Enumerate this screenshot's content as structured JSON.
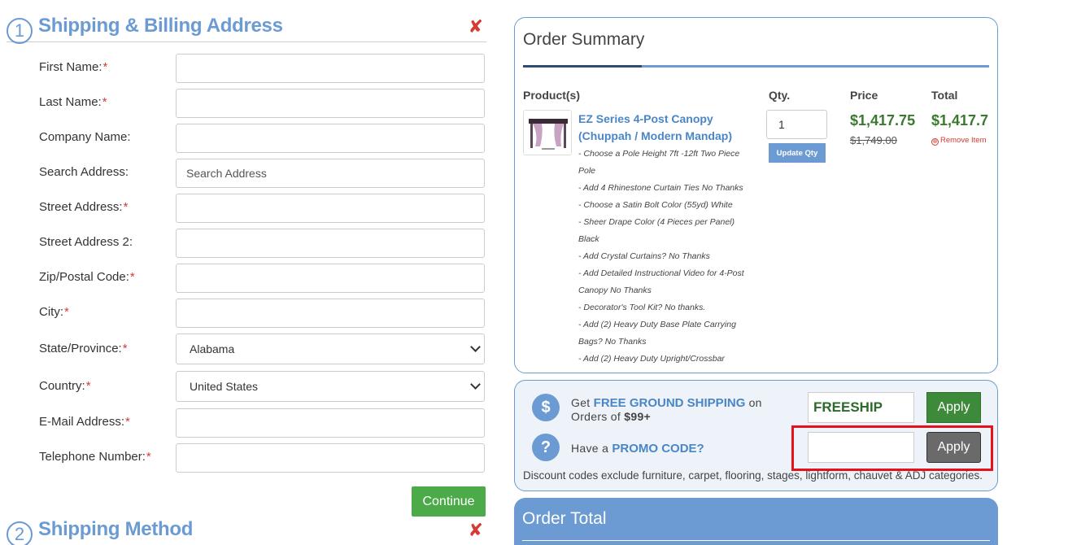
{
  "shipping": {
    "step": "1",
    "title": "Shipping & Billing Address",
    "close_icon": "✘",
    "fields": [
      {
        "label": "First Name:",
        "required": "*",
        "value": "",
        "placeholder": ""
      },
      {
        "label": "Last Name:",
        "required": "*",
        "value": "",
        "placeholder": ""
      },
      {
        "label": "Company Name:",
        "required": "",
        "value": "",
        "placeholder": ""
      },
      {
        "label": "Search Address:",
        "required": "",
        "value": "",
        "placeholder": "Search Address"
      },
      {
        "label": "Street Address:",
        "required": "*",
        "value": "",
        "placeholder": ""
      },
      {
        "label": "Street Address 2:",
        "required": "",
        "value": "",
        "placeholder": ""
      },
      {
        "label": "Zip/Postal Code:",
        "required": "*",
        "value": "",
        "placeholder": ""
      },
      {
        "label": "City:",
        "required": "*",
        "value": "",
        "placeholder": ""
      },
      {
        "label": "State/Province:",
        "required": "*",
        "selected": "Alabama"
      },
      {
        "label": "Country:",
        "required": "*",
        "selected": "United States"
      },
      {
        "label": "E-Mail Address:",
        "required": "*",
        "value": "",
        "placeholder": ""
      },
      {
        "label": "Telephone Number:",
        "required": "*",
        "value": "",
        "placeholder": ""
      }
    ],
    "continue_label": "Continue"
  },
  "shipping_method": {
    "step": "2",
    "title": "Shipping Method",
    "close_icon": "✘"
  },
  "summary": {
    "title": "Order Summary",
    "headers": {
      "products": "Product(s)",
      "qty": "Qty.",
      "price": "Price",
      "total": "Total"
    },
    "item": {
      "name": "EZ Series 4-Post Canopy (Chuppah / Modern Mandap)",
      "options": [
        "- Choose a Pole Height 7ft -12ft Two Piece Pole",
        "- Add 4 Rhinestone Curtain Ties No Thanks",
        "- Choose a Satin Bolt Color (55yd) White",
        "- Sheer Drape Color (4 Pieces per Panel) Black",
        "- Add Crystal Curtains? No Thanks",
        "- Add Detailed Instructional Video for 4-Post Canopy No Thanks",
        "- Decorator's Tool Kit? No thanks.",
        "- Add (2) Heavy Duty Base Plate Carrying Bags? No Thanks",
        "- Add (2) Heavy Duty Upright/Crossbar"
      ],
      "qty": "1",
      "update_label": "Update Qty",
      "price": "$1,417.75",
      "old_price": "$1,749.00",
      "total": "$1,417.7",
      "remove_label": "Remove Item",
      "remove_icon": "⊗"
    }
  },
  "promo": {
    "ship_icon": "$",
    "ship_pre": "Get",
    "ship_highlight": "FREE GROUND SHIPPING",
    "ship_mid": "on",
    "ship_line2_pre": "Orders of",
    "ship_amount": "$99+",
    "ship_code": "FREESHIP",
    "apply_label": "Apply",
    "promo_icon": "?",
    "promo_pre": "Have a",
    "promo_highlight": "PROMO CODE?",
    "promo_value": "",
    "disclaimer": "Discount codes exclude furniture, carpet, flooring, stages, lightform, chauvet & ADJ categories."
  },
  "order_total": {
    "title": "Order Total"
  },
  "colors": {
    "accent": "#6b9bd2",
    "price_green": "#3a7a2e",
    "continue_green": "#4caa48",
    "required_red": "#d63a33",
    "highlight_red": "#e8101a"
  }
}
